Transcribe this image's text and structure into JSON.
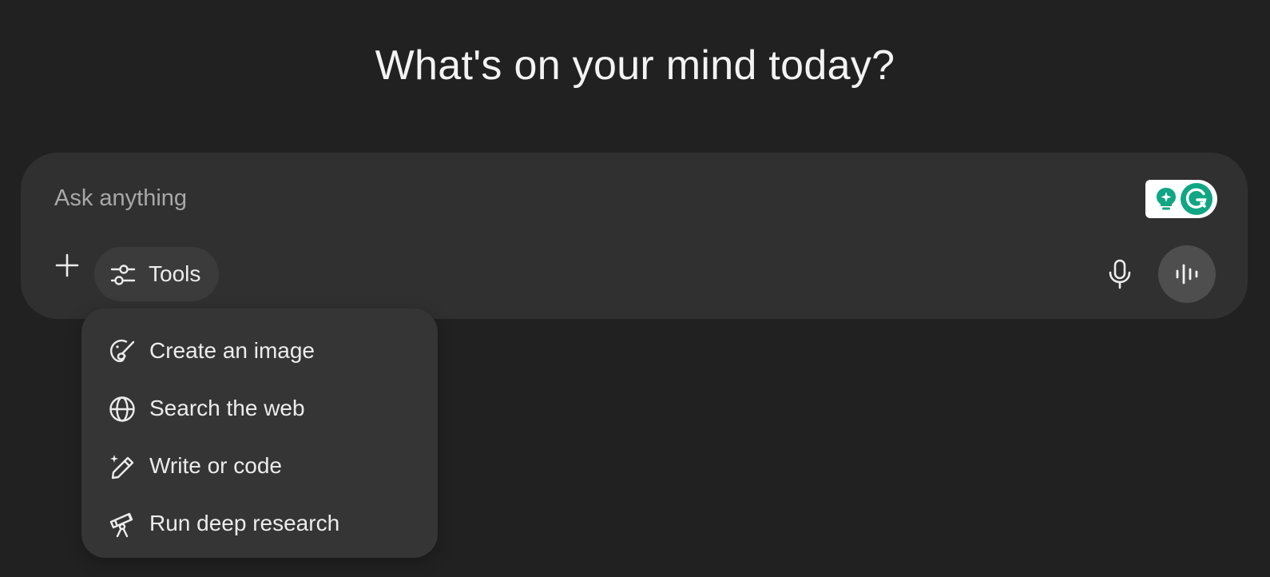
{
  "heading": "What's on your mind today?",
  "composer": {
    "placeholder": "Ask anything",
    "tools_label": "Tools"
  },
  "tools_menu": {
    "items": [
      {
        "label": "Create an image",
        "icon": "image-brush-icon"
      },
      {
        "label": "Search the web",
        "icon": "globe-icon"
      },
      {
        "label": "Write or code",
        "icon": "pencil-sparkle-icon"
      },
      {
        "label": "Run deep research",
        "icon": "telescope-icon"
      }
    ]
  },
  "icons": {
    "add": "plus-icon",
    "tools": "sliders-icon",
    "mic": "microphone-icon",
    "voice": "voice-waveform-icon",
    "grammarly_suggestions": "lightbulb-icon",
    "grammarly": "grammarly-logo-icon"
  },
  "colors": {
    "background": "#212121",
    "composer": "#303030",
    "menu": "#353535",
    "grammarly_green": "#11a683"
  }
}
